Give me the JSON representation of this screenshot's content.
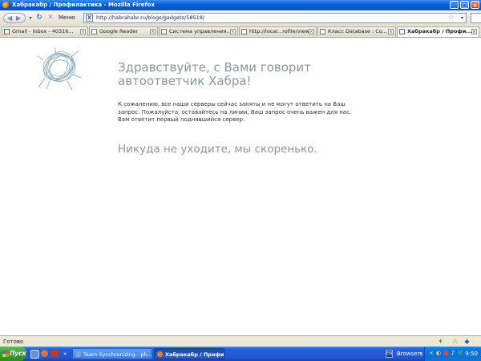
{
  "window": {
    "title": "Хабракабр / Профилактика - Mozilla Firefox"
  },
  "navbar": {
    "menu_label": "Меню",
    "url": "http://habrahabr.ru/blogs/gadgets/58518/",
    "site_favicon": "Х"
  },
  "tabs": [
    {
      "label": "Gmail - Inbox - 40316...",
      "icon": "gmail-icon",
      "active": false
    },
    {
      "label": "Google Reader",
      "icon": "page-icon",
      "active": false
    },
    {
      "label": "Система управления...",
      "icon": "page-icon",
      "active": false
    },
    {
      "label": "http://local...rofile/view",
      "icon": "page-icon",
      "active": false
    },
    {
      "label": "Класс Database : Co...",
      "icon": "page-icon",
      "active": false
    },
    {
      "label": "Хабракабр / Профи...",
      "icon": "habr-icon",
      "active": true
    }
  ],
  "page": {
    "greeting": "Здравствуйте, с Вами говорит автоответчик Хабра!",
    "message": "К сожалению, все наши серверы сейчас заняты и не могут ответить на Ваш запрос. Пожалуйста, оставайтесь на линии, Ваш запрос очень важен для нас. Вам ответит первый поднявшийся сервер.",
    "farewell": "Никуда не уходите, мы скоренько."
  },
  "statusbar": {
    "text": "Готово"
  },
  "taskbar": {
    "start_label": "Пуск",
    "buttons": [
      {
        "label": "Team Synchronizing - ph...",
        "active": false
      },
      {
        "label": "Хабракабр / Профиль...",
        "active": true
      }
    ],
    "language": "EN",
    "toolbar_label": "Browsers",
    "clock": "9:50"
  },
  "colors": {
    "heading": "#8a96a0",
    "taskbar": "#245edb",
    "start": "#3a9a36"
  }
}
